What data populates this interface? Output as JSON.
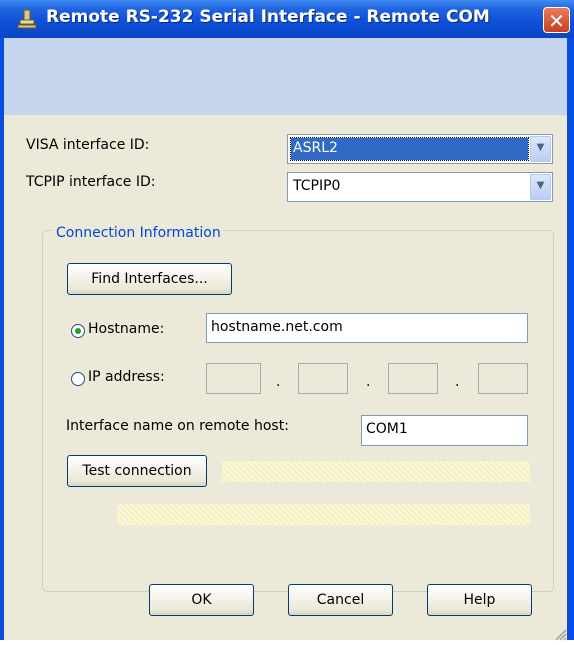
{
  "window": {
    "title": "Remote RS-232 Serial Interface - Remote COM",
    "close_glyph": "✕"
  },
  "visa": {
    "label": "VISA interface ID:",
    "value": "ASRL2"
  },
  "tcpip": {
    "label": "TCPIP interface ID:",
    "value": "TCPIP0"
  },
  "connection": {
    "group_title": "Connection Information",
    "find_button": "Find Interfaces...",
    "hostname_label": "Hostname:",
    "hostname_value": "hostname.net.com",
    "hostname_selected": true,
    "ip_label": "IP address:",
    "ip_selected": false,
    "ip_separator": ".",
    "remote_label": "Interface name on remote host:",
    "remote_value": "COM1",
    "test_button": "Test connection"
  },
  "buttons": {
    "ok": "OK",
    "cancel": "Cancel",
    "help": "Help"
  },
  "colors": {
    "titlebar": "#0a4ee0",
    "dialog_bg": "#ece9d8",
    "banner": "#c7d6ef",
    "group_title": "#0046d5",
    "selection": "#316ac5"
  },
  "icons": {
    "title": "serial-port-icon",
    "combo_arrow": "chevron-down-icon"
  }
}
